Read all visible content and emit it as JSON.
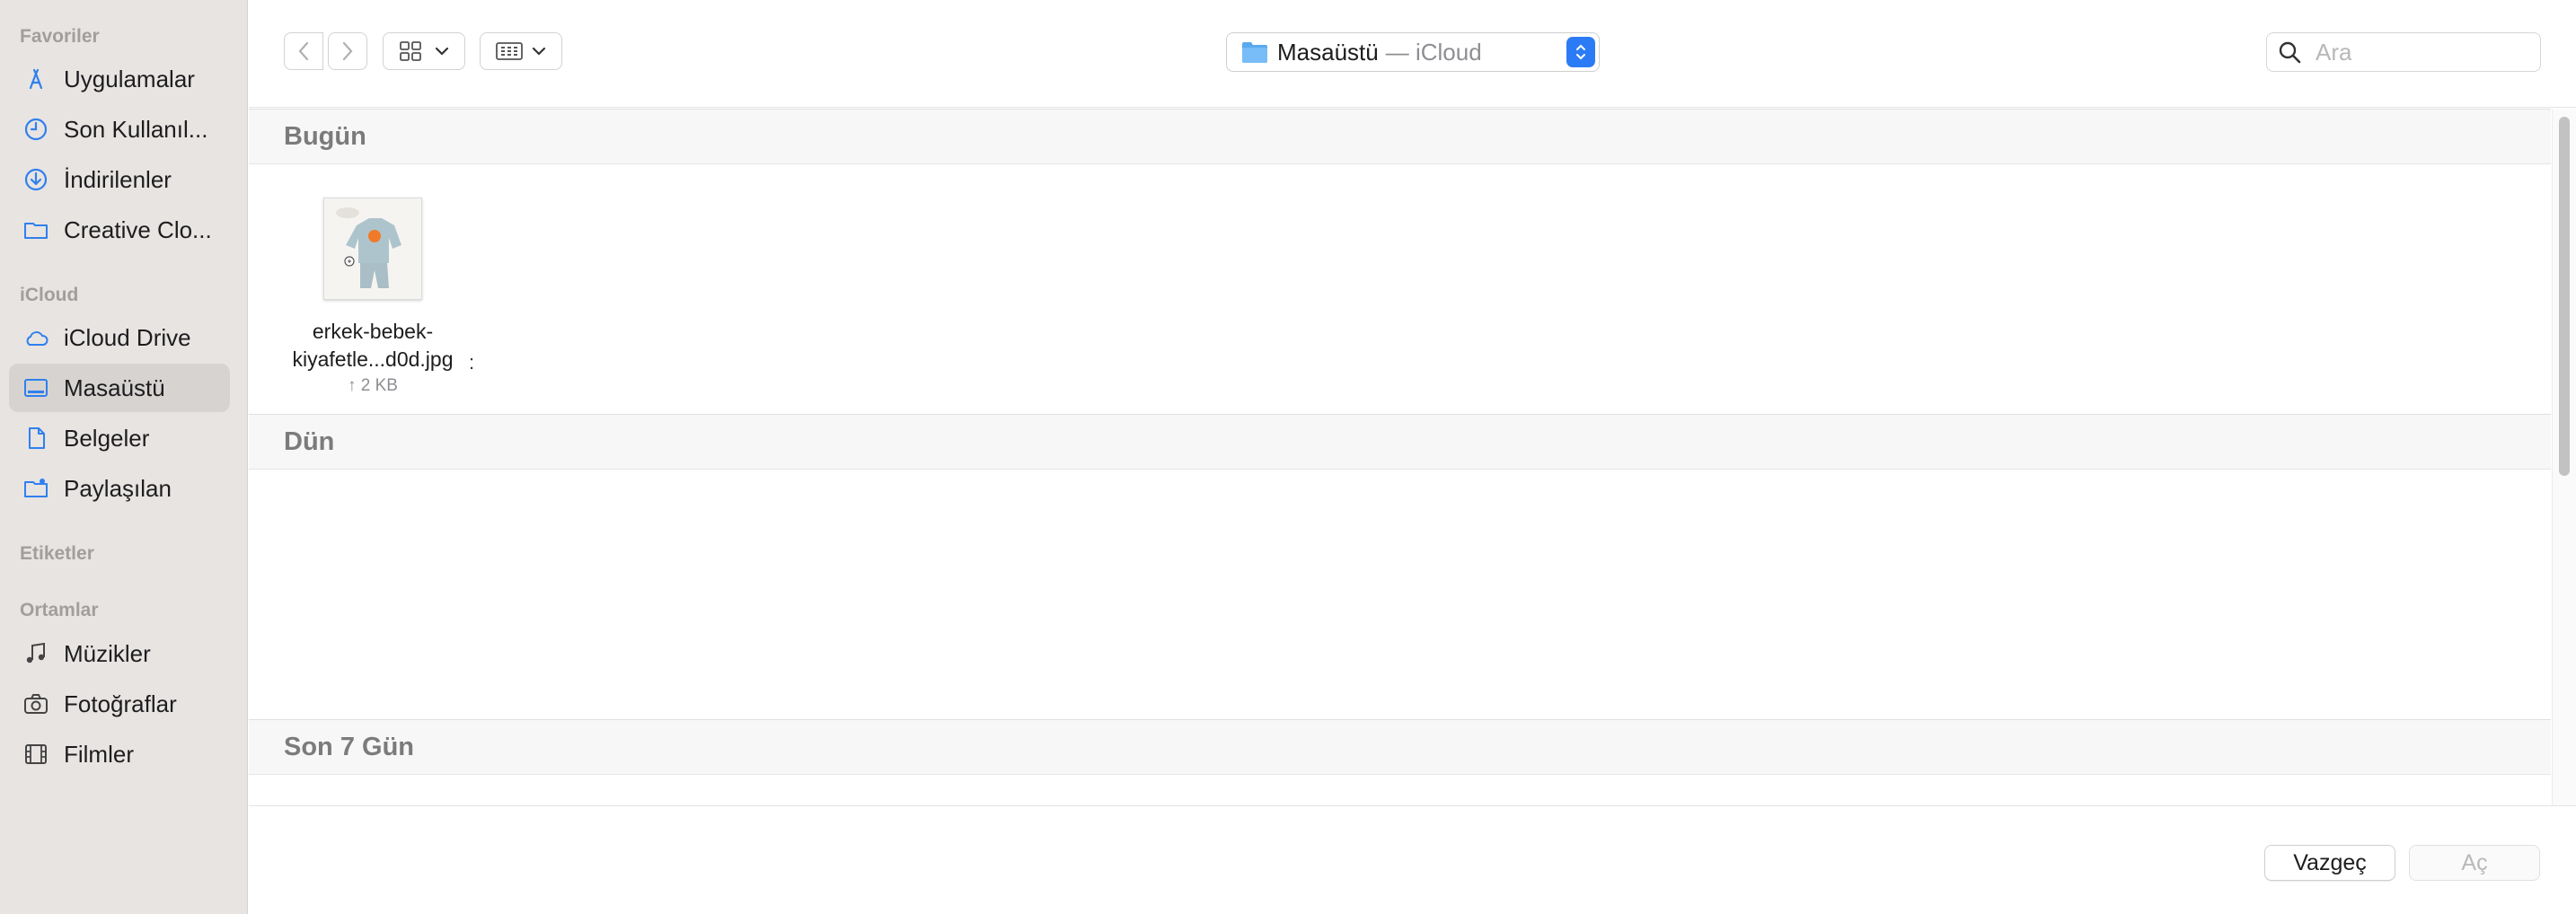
{
  "sidebar": {
    "favorites_header": "Favoriler",
    "favorites": [
      {
        "label": "Uygulamalar",
        "icon": "applications-icon"
      },
      {
        "label": "Son Kullanıl...",
        "icon": "recents-clock-icon"
      },
      {
        "label": "İndirilenler",
        "icon": "downloads-icon"
      },
      {
        "label": "Creative Clo...",
        "icon": "folder-icon"
      }
    ],
    "icloud_header": "iCloud",
    "icloud": [
      {
        "label": "iCloud Drive",
        "icon": "cloud-icon"
      },
      {
        "label": "Masaüstü",
        "icon": "desktop-icon",
        "selected": true
      },
      {
        "label": "Belgeler",
        "icon": "document-icon"
      },
      {
        "label": "Paylaşılan",
        "icon": "shared-folder-icon"
      }
    ],
    "tags_header": "Etiketler",
    "locations_header": "Ortamlar",
    "locations": [
      {
        "label": "Müzikler",
        "icon": "music-note-icon"
      },
      {
        "label": "Fotoğraflar",
        "icon": "camera-icon"
      },
      {
        "label": "Filmler",
        "icon": "film-icon"
      }
    ]
  },
  "toolbar": {
    "location_name": "Masaüstü",
    "location_suffix": "— iCloud",
    "search_placeholder": "Ara"
  },
  "content": {
    "groups": [
      {
        "title": "Bugün"
      },
      {
        "title": "Dün"
      },
      {
        "title": "Son 7 Gün"
      }
    ],
    "files": [
      {
        "name_line1": "erkek-bebek-",
        "name_line2": "kiyafetle...d0d.jpg",
        "size": "↑ 2 KB"
      }
    ],
    "stray_char": ":"
  },
  "buttons": {
    "cancel": "Vazgeç",
    "open": "Aç"
  },
  "colors": {
    "accent": "#2c7bf6",
    "sidebar_icon": "#2f80ed",
    "sidebar_bg": "#e8e4e2",
    "selected_bg": "#d7d3d1"
  }
}
